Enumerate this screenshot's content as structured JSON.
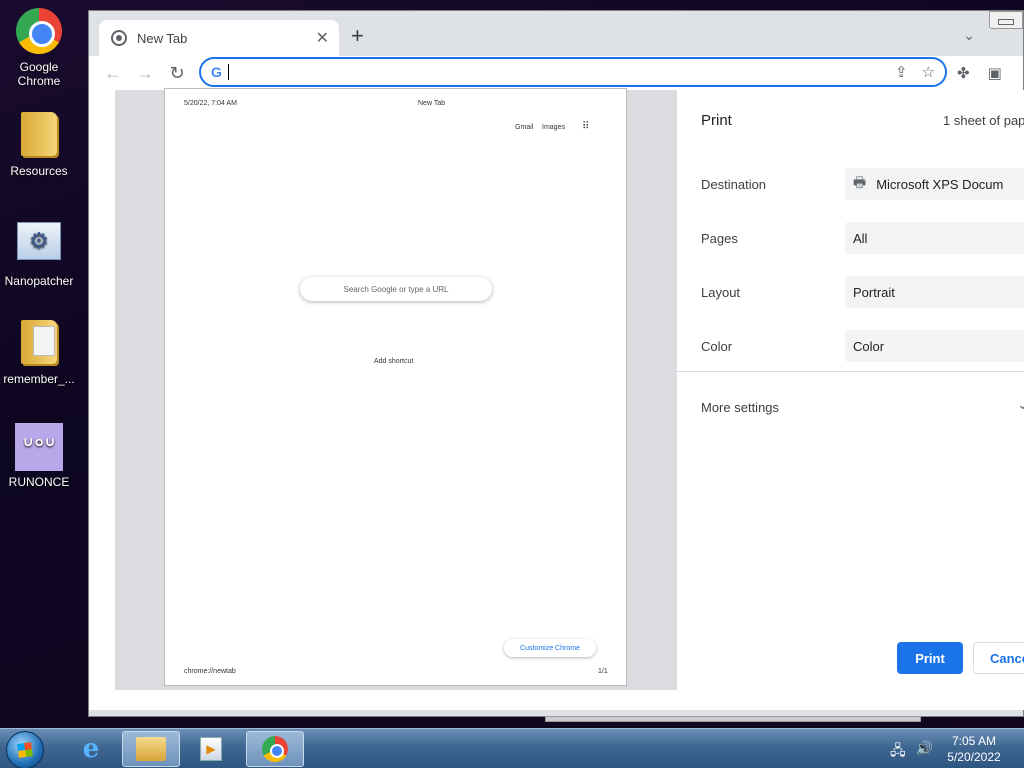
{
  "desktop": {
    "icons": [
      {
        "label": "Google\nChrome",
        "icon": "chrome-icon"
      },
      {
        "label": "Resources",
        "icon": "folder-icon"
      },
      {
        "label": "Nanopatcher",
        "icon": "nanopatcher-icon"
      },
      {
        "label": "remember_...",
        "icon": "folder-icon"
      },
      {
        "label": "RUNONCE",
        "icon": "bunny-icon"
      }
    ]
  },
  "browser": {
    "tab_title": "New Tab",
    "tab_close": "✕",
    "new_tab": "+",
    "tab_search": "⌄",
    "back": "←",
    "forward": "→",
    "reload": "↻",
    "omnibox_value": "",
    "omnibox_g": "G",
    "share_icon": "⇪",
    "star_icon": "☆",
    "ext_icon": "✤",
    "sidepanel_icon": "▣"
  },
  "preview": {
    "header_date": "5/20/22, 7:04 AM",
    "header_title": "New Tab",
    "gmail": "Gmail",
    "images": "Images",
    "apps": "⠿",
    "search_placeholder": "Search Google or type a URL",
    "add_shortcut": "Add shortcut",
    "customize": "Customize Chrome",
    "footer_url": "chrome://newtab",
    "footer_page": "1/1"
  },
  "print": {
    "title": "Print",
    "sheets": "1 sheet of pap",
    "destination_label": "Destination",
    "destination_value": "Microsoft XPS Docum",
    "pages_label": "Pages",
    "pages_value": "All",
    "layout_label": "Layout",
    "layout_value": "Portrait",
    "color_label": "Color",
    "color_value": "Color",
    "more_settings": "More settings",
    "print_button": "Print",
    "cancel_button": "Cance",
    "dropdown_arrow": "▾",
    "more_chevron": "⌄"
  },
  "taskbar": {
    "ie": "e",
    "media": "▶",
    "time": "7:05 AM",
    "date": "5/20/2022",
    "network_icon": "🖧",
    "volume_icon": "🔊"
  },
  "colors": {
    "accent": "#1a73e8"
  }
}
